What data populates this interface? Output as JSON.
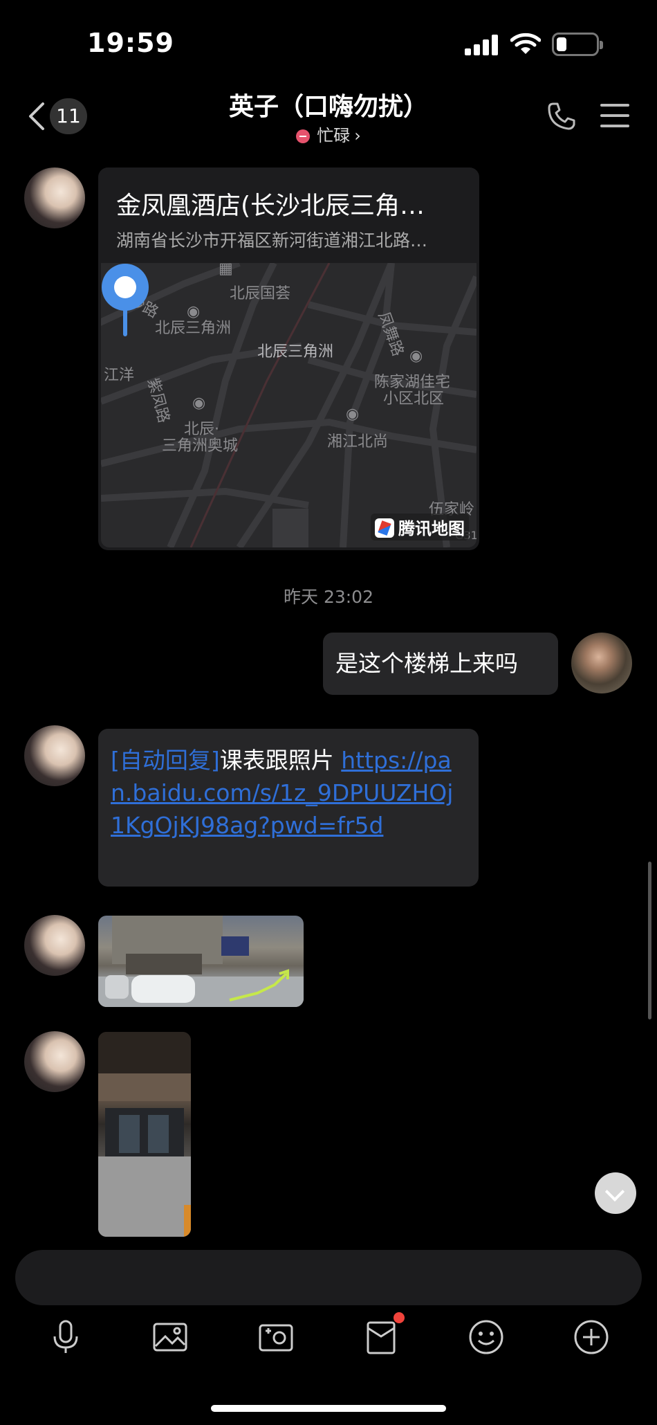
{
  "status_bar": {
    "time": "19:59"
  },
  "header": {
    "unread_count": "11",
    "contact_name": "英子（口嗨勿扰）",
    "status_text": "忙碌",
    "status_chevron": "›"
  },
  "location_card": {
    "title": "金凤凰酒店(长沙北辰三角…",
    "address": "湖南省长沙市开福区新河街道湘江北路…",
    "map_labels": [
      "平沙路",
      "北辰国荟",
      "北辰三角洲",
      "北辰三角洲",
      "江洋",
      "凤舞路",
      "陈家湖佳宅",
      "小区北区",
      "紫凤路",
      "北辰·",
      "三角洲奥城",
      "湘江北尚",
      "伍家岭",
      "G31"
    ],
    "map_provider": "腾讯地图"
  },
  "time_divider": "昨天 23:02",
  "messages": {
    "outgoing_text": "是这个楼梯上来吗",
    "auto_reply_tag": "[自动回复]",
    "auto_reply_text": "课表跟照片 ",
    "auto_reply_url": "https://pan.baidu.com/s/1z_9DPUUZHOj1KgOjKJ98ag?pwd=fr5d"
  },
  "input": {
    "placeholder": ""
  },
  "toolbar": {
    "icons": [
      "microphone-icon",
      "photo-album-icon",
      "camera-icon",
      "red-packet-icon",
      "emoji-icon",
      "plus-icon"
    ]
  }
}
